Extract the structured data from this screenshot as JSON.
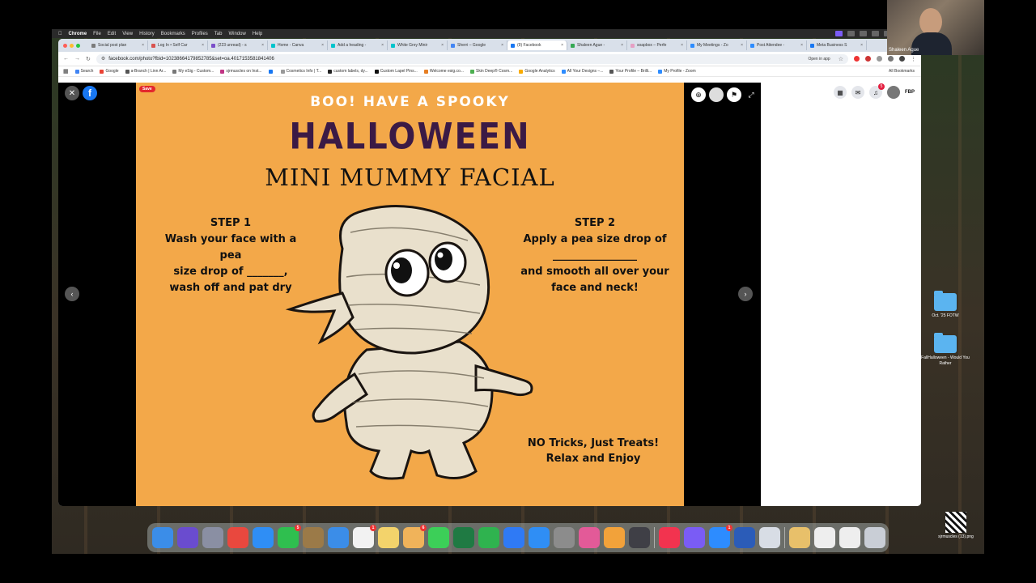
{
  "menubar": {
    "app": "Chrome",
    "items": [
      "File",
      "Edit",
      "View",
      "History",
      "Bookmarks",
      "Profiles",
      "Tab",
      "Window",
      "Help"
    ]
  },
  "tabs": [
    {
      "label": "Social post plan",
      "color": "#7b7b7b"
    },
    {
      "label": "Log In • Self Car",
      "color": "#d9534f"
    },
    {
      "label": "(223 unread) - s",
      "color": "#7b4fc9"
    },
    {
      "label": "Home - Canva",
      "color": "#00c4cc"
    },
    {
      "label": "Add a heading -",
      "color": "#00c4cc"
    },
    {
      "label": "White Grey Minir",
      "color": "#00c4cc"
    },
    {
      "label": "Sherri – Google",
      "color": "#4285f4"
    },
    {
      "label": "(9) Facebook",
      "color": "#1877f2"
    },
    {
      "label": "Shaleen Ague -",
      "color": "#34a853"
    },
    {
      "label": "soapbox – Perfe",
      "color": "#e6a0c4"
    },
    {
      "label": "My Meetings - Zo",
      "color": "#2d8cff"
    },
    {
      "label": "Post Attendee -",
      "color": "#2d8cff"
    },
    {
      "label": "Meta Business S",
      "color": "#1877f2"
    }
  ],
  "address": {
    "url": "facebook.com/photo?fbid=10238664179852785&set=oa.4017153581841406",
    "open_in_app": "Open in app"
  },
  "bookmarks": [
    {
      "label": "Search",
      "color": "#4285f4"
    },
    {
      "label": "Google",
      "color": "#ea4335"
    },
    {
      "label": "a-Branch | Linn Ar...",
      "color": "#555"
    },
    {
      "label": "My eSig - Custom...",
      "color": "#777"
    },
    {
      "label": "sjrmuscles on Inst...",
      "color": "#c13584"
    },
    {
      "label": "",
      "color": "#1877f2"
    },
    {
      "label": "Cosmetics Info | T...",
      "color": "#999"
    },
    {
      "label": "custom labels, dy...",
      "color": "#222"
    },
    {
      "label": "Custom Lapel Pins...",
      "color": "#111"
    },
    {
      "label": "Welcome esig.co...",
      "color": "#e67e22"
    },
    {
      "label": "Skin Deep® Cosm...",
      "color": "#4caf50"
    },
    {
      "label": "Google Analytics",
      "color": "#f9ab00"
    },
    {
      "label": "All Your Designs –...",
      "color": "#2d8cff"
    },
    {
      "label": "Your Profile – Brilli...",
      "color": "#555"
    },
    {
      "label": "My Profile - Zoom",
      "color": "#2d8cff"
    }
  ],
  "all_bookmarks": "All Bookmarks",
  "viewer": {
    "save_label": "Save"
  },
  "fb_right": {
    "notif_count": "5",
    "profile_label": "FBP"
  },
  "poster": {
    "top_line": "BOO! HAVE A SPOOKY",
    "headline": "HALLOWEEN",
    "subtitle": "MINI MUMMY FACIAL",
    "step1_title": "STEP 1",
    "step1_lines": [
      "Wash your face with a pea",
      "size drop of _______,",
      "wash off and pat dry"
    ],
    "step2_title": "STEP 2",
    "step2_lines": [
      "Apply a pea size drop of",
      "________________",
      "and smooth all over your",
      "face and neck!"
    ],
    "tricks_lines": [
      "NO Tricks, Just Treats!",
      "Relax and Enjoy"
    ],
    "bg_color": "#f3a849",
    "headline_color": "#3b1a45"
  },
  "desktop_icons": [
    {
      "label": "Oct. '25 FOTW"
    },
    {
      "label": "FallHalloween - Would You Rather"
    },
    {
      "label": "sjrmuscles (13).png"
    }
  ],
  "webcam": {
    "name": "Shaleen Ague"
  },
  "dock": {
    "apps": [
      {
        "name": "Finder",
        "color": "#3b8de8",
        "badge": ""
      },
      {
        "name": "Siri",
        "color": "#6a4ccf",
        "badge": ""
      },
      {
        "name": "Launchpad",
        "color": "#8a8fa3",
        "badge": ""
      },
      {
        "name": "Chrome",
        "color": "#e9483e",
        "badge": ""
      },
      {
        "name": "Safari",
        "color": "#2f8ef5",
        "badge": ""
      },
      {
        "name": "FaceTime",
        "color": "#2fbf4f",
        "badge": "5"
      },
      {
        "name": "Notes",
        "color": "#9b7a48",
        "badge": ""
      },
      {
        "name": "Mail",
        "color": "#3b8de8",
        "badge": ""
      },
      {
        "name": "Reminders",
        "color": "#f2f2f2",
        "badge": "1"
      },
      {
        "name": "Stickies",
        "color": "#f3d36b",
        "badge": ""
      },
      {
        "name": "Photos",
        "color": "#f0b35a",
        "badge": "6"
      },
      {
        "name": "Messages",
        "color": "#3ccf58",
        "badge": ""
      },
      {
        "name": "Excel",
        "color": "#1f7a43",
        "badge": ""
      },
      {
        "name": "Numbers",
        "color": "#2fb34f",
        "badge": ""
      },
      {
        "name": "Keynote",
        "color": "#2f7af5",
        "badge": ""
      },
      {
        "name": "App Store",
        "color": "#2f8ef5",
        "badge": ""
      },
      {
        "name": "Settings",
        "color": "#8c8c8c",
        "badge": ""
      },
      {
        "name": "Preview",
        "color": "#e35a98",
        "badge": ""
      },
      {
        "name": "Home",
        "color": "#f2a23a",
        "badge": ""
      },
      {
        "name": "iPhone Mirroring",
        "color": "#3f3f46",
        "badge": ""
      },
      {
        "name": "Music",
        "color": "#f2334f",
        "badge": ""
      },
      {
        "name": "Messenger",
        "color": "#7a5cf5",
        "badge": ""
      },
      {
        "name": "Zoom",
        "color": "#2d8cff",
        "badge": "1"
      },
      {
        "name": "Word",
        "color": "#2b5cb8",
        "badge": ""
      },
      {
        "name": "Screenshot",
        "color": "#d8dde5",
        "badge": ""
      }
    ]
  }
}
